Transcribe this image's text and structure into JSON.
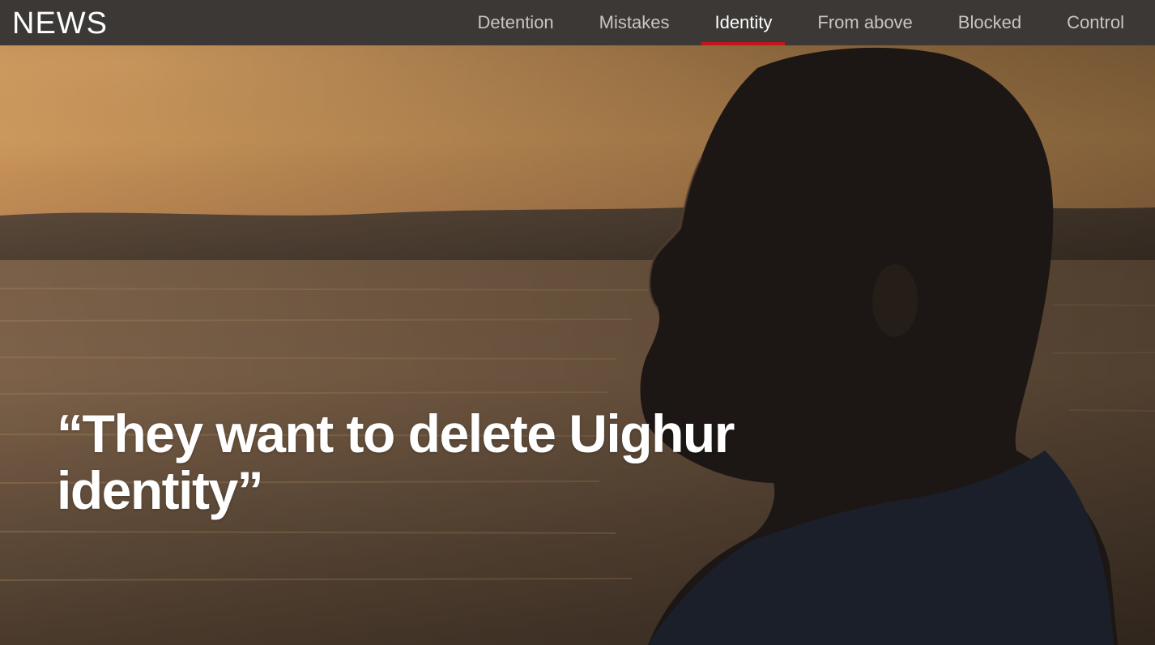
{
  "header": {
    "logo_text": "NEWS"
  },
  "nav": {
    "items": [
      {
        "label": "Detention",
        "active": false
      },
      {
        "label": "Mistakes",
        "active": false
      },
      {
        "label": "Identity",
        "active": true
      },
      {
        "label": "From above",
        "active": false
      },
      {
        "label": "Blocked",
        "active": false
      },
      {
        "label": "Control",
        "active": false
      }
    ]
  },
  "hero": {
    "headline": "“They want to delete Uighur identity”",
    "image_subject": "silhouette-of-bearded-man-at-sunset-by-water"
  },
  "colors": {
    "nav_bg": "#3b3835",
    "active_underline": "#c4161c",
    "sky": "#c8925a",
    "water": "#6b5843"
  }
}
